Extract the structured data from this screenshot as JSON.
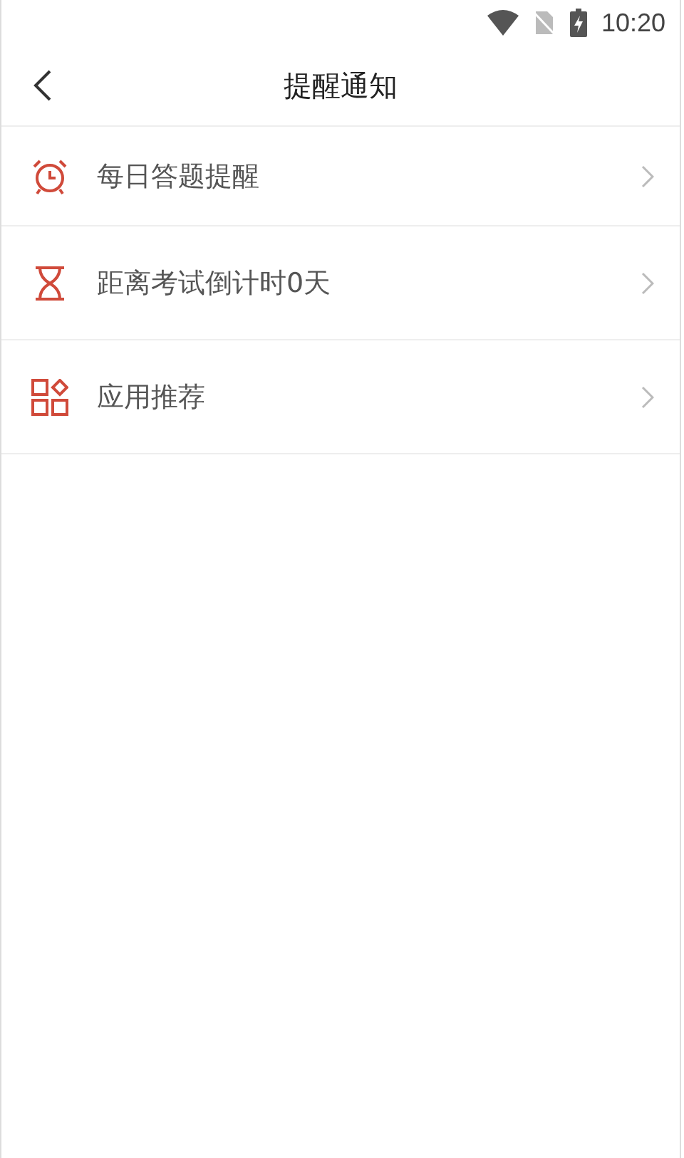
{
  "status_bar": {
    "time": "10:20"
  },
  "header": {
    "title": "提醒通知"
  },
  "items": [
    {
      "kind": "alarm",
      "label": "每日答题提醒"
    },
    {
      "kind": "hourglass",
      "label": "距离考试倒计时0天"
    },
    {
      "kind": "apps",
      "label": "应用推荐"
    }
  ]
}
